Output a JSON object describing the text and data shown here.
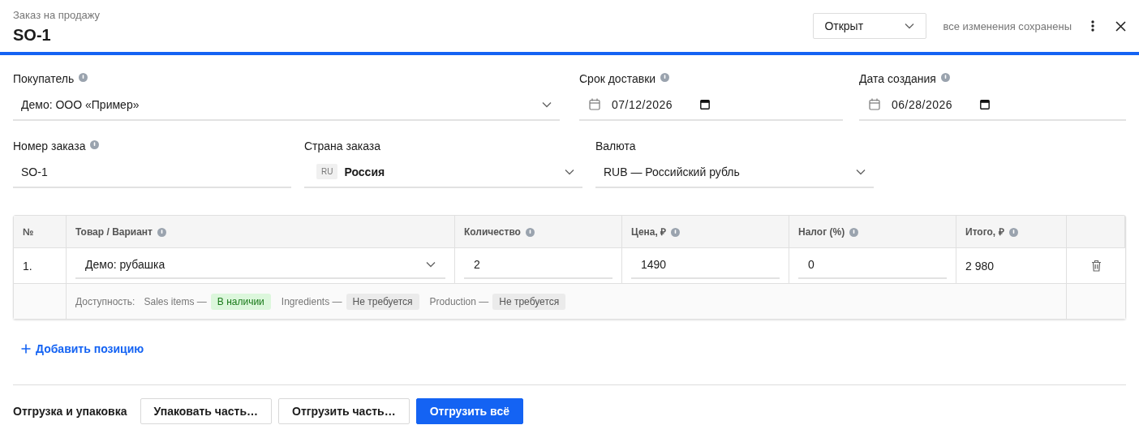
{
  "header": {
    "subtitle": "Заказ на продажу",
    "title": "SO-1",
    "status": "Открыт",
    "save_note": "все изменения сохранены"
  },
  "fields_row_1": [
    {
      "kind": "select",
      "label": "Покупатель",
      "info": true,
      "value": "Демо: ООО «Пример»"
    },
    {
      "kind": "date",
      "label": "Срок доставки",
      "info": true,
      "value": "07/12/2026"
    },
    {
      "kind": "date",
      "label": "Дата создания",
      "info": true,
      "value": "06/28/2026"
    }
  ],
  "fields_row_2": [
    {
      "kind": "text",
      "label": "Номер заказа",
      "info": true,
      "value": "SO-1"
    },
    {
      "kind": "country",
      "label": "Страна заказа",
      "info": false,
      "code": "RU",
      "value": "Россия"
    },
    {
      "kind": "select",
      "label": "Валюта",
      "info": false,
      "value": "RUB — Российский рубль"
    }
  ],
  "table": {
    "columns": [
      {
        "label": "№",
        "info": false
      },
      {
        "label": "Товар / Вариант",
        "info": true
      },
      {
        "label": "Количество",
        "info": true
      },
      {
        "label": "Цена, ₽",
        "info": true
      },
      {
        "label": "Налог (%)",
        "info": true
      },
      {
        "label": "Итого, ₽",
        "info": true
      }
    ],
    "rows": [
      {
        "number": "1.",
        "product": "Демо: рубашка",
        "quantity": "2",
        "price": "1490",
        "tax": "0",
        "total": "2 980",
        "availability": {
          "label": "Доступность:",
          "items": [
            {
              "name": "Sales items —",
              "status": "В наличии",
              "color": "#dcf7dc"
            },
            {
              "name": "Ingredients —",
              "status": "Не требуется",
              "color": "#ebebeb"
            },
            {
              "name": "Production —",
              "status": "Не требуется",
              "color": "#ebebeb"
            }
          ]
        }
      }
    ]
  },
  "add_line": "Добавить позицию",
  "footer": {
    "title": "Отгрузка и упаковка",
    "buttons": [
      {
        "label": "Упаковать часть…",
        "kind": "secondary"
      },
      {
        "label": "Отгрузить часть…",
        "kind": "secondary"
      },
      {
        "label": "Отгрузить всё",
        "kind": "primary"
      }
    ]
  }
}
